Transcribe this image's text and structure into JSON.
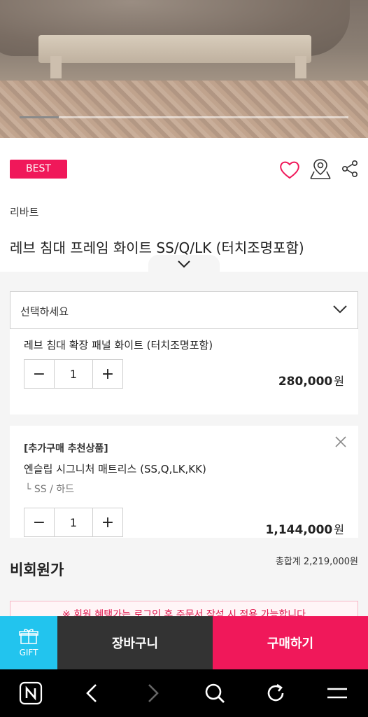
{
  "hero": {
    "slide_progress": 0.12
  },
  "badge": {
    "label": "BEST"
  },
  "actions": {
    "wishlist_icon": "heart-icon",
    "store_icon": "map-pin-icon",
    "share_icon": "share-icon",
    "color": "#f0185a"
  },
  "product": {
    "brand": "리바트",
    "title": "레브 침대 프레임 화이트 SS/Q/LK (터치조명포함)"
  },
  "option_select": {
    "placeholder": "선택하세요"
  },
  "selected_items": [
    {
      "name": "레브 침대 확장 패널 화이트 (터치조명포함)",
      "quantity": "1",
      "price": "280,000",
      "currency": "원"
    },
    {
      "tag": "[추가구매 추천상품]",
      "name": "엔슬립 시그니처 매트리스 (SS,Q,LK,KK)",
      "sub_option": "└  SS / 하드",
      "quantity": "1",
      "price": "1,144,000",
      "currency": "원"
    }
  ],
  "summary": {
    "guest_price_label": "비회원가",
    "total": "총합계 2,219,000원"
  },
  "notice": {
    "text": "※ 회원 혜택가는 로그인 후 주문서 작성 시 적용 가능합니다"
  },
  "bottom_bar": {
    "gift_label": "GIFT",
    "cart_label": "장바구니",
    "buy_label": "구매하기"
  },
  "colors": {
    "accent": "#f0185a",
    "gift": "#22c4ee",
    "cart": "#333333"
  }
}
